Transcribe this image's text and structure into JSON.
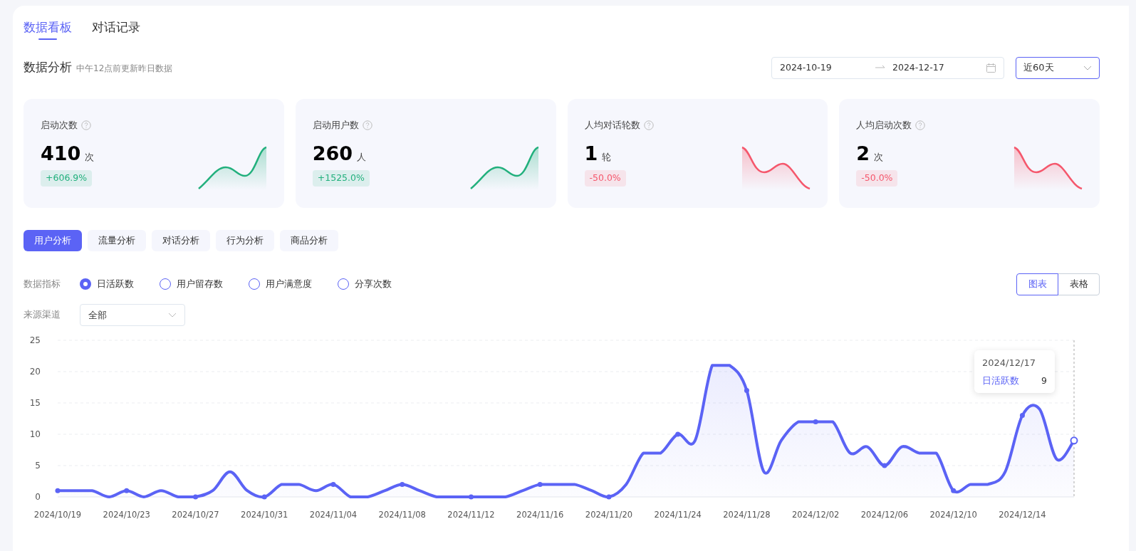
{
  "tabs": [
    {
      "label": "数据看板",
      "selected": true
    },
    {
      "label": "对话记录",
      "selected": false
    }
  ],
  "header": {
    "title": "数据分析",
    "note": "中午12点前更新昨日数据",
    "date_start": "2024-10-19",
    "date_end": "2024-12-17",
    "period": "近60天"
  },
  "stats": [
    {
      "label": "启动次数",
      "value": "410",
      "unit": "次",
      "change": "+606.9%",
      "color": "#22b07d"
    },
    {
      "label": "启动用户数",
      "value": "260",
      "unit": "人",
      "change": "+1525.0%",
      "color": "#22b07d"
    },
    {
      "label": "人均对话轮数",
      "value": "1",
      "unit": "轮",
      "change": "-50.0%",
      "color": "#f5576c"
    },
    {
      "label": "人均启动次数",
      "value": "2",
      "unit": "次",
      "change": "-50.0%",
      "color": "#f5576c"
    }
  ],
  "analysis_tabs": [
    {
      "label": "用户分析",
      "selected": true
    },
    {
      "label": "流量分析",
      "selected": false
    },
    {
      "label": "对话分析",
      "selected": false
    },
    {
      "label": "行为分析",
      "selected": false
    },
    {
      "label": "商品分析",
      "selected": false
    }
  ],
  "metrics": {
    "label": "数据指标",
    "options": [
      {
        "label": "日活跃数",
        "selected": true
      },
      {
        "label": "用户留存数",
        "selected": false
      },
      {
        "label": "用户满意度",
        "selected": false
      },
      {
        "label": "分享次数",
        "selected": false
      }
    ]
  },
  "view_toggle": [
    {
      "label": "图表",
      "selected": true
    },
    {
      "label": "表格",
      "selected": false
    }
  ],
  "source": {
    "label": "来源渠道",
    "value": "全部"
  },
  "chart": {
    "chart_data": {
      "type": "area",
      "grid": true,
      "categories": [
        "2024/10/19",
        null,
        null,
        null,
        "2024/10/23",
        null,
        null,
        null,
        "2024/10/27",
        null,
        null,
        null,
        "2024/10/31",
        null,
        null,
        null,
        "2024/11/04",
        null,
        null,
        null,
        "2024/11/08",
        null,
        null,
        null,
        "2024/11/12",
        null,
        null,
        null,
        "2024/11/16",
        null,
        null,
        null,
        "2024/11/20",
        null,
        null,
        null,
        "2024/11/24",
        null,
        null,
        null,
        "2024/11/28",
        null,
        null,
        null,
        "2024/12/02",
        null,
        null,
        null,
        "2024/12/06",
        null,
        null,
        null,
        "2024/12/10",
        null,
        null,
        null,
        "2024/12/14",
        null,
        null,
        null
      ],
      "series": [
        {
          "name": "日活跃数",
          "color": "#5b63f5",
          "values": [
            1,
            1,
            1,
            0,
            1,
            0,
            1,
            0,
            0,
            1,
            4,
            1,
            0,
            2,
            2,
            1,
            2,
            0,
            0,
            1,
            2,
            1,
            0,
            0,
            0,
            0,
            0,
            1,
            2,
            2,
            2,
            1,
            0,
            2,
            7,
            7,
            10,
            9,
            21,
            21,
            17,
            4,
            9,
            12,
            12,
            12,
            7,
            8,
            5,
            8,
            7,
            7,
            1,
            2,
            2,
            4,
            13,
            14,
            6,
            9
          ]
        }
      ],
      "ylim": [
        0,
        25
      ],
      "yticks": [
        0,
        5,
        10,
        15,
        20,
        25
      ]
    },
    "tooltip": {
      "date": "2024/12/17",
      "value": "9"
    }
  }
}
